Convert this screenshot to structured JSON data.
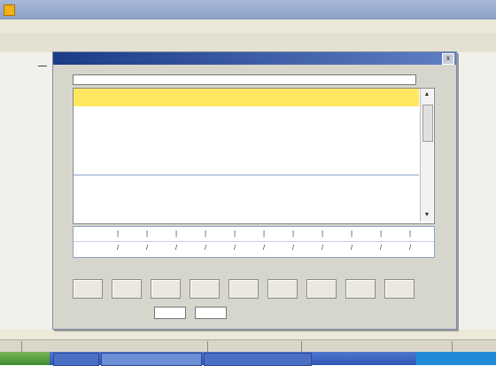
{
  "app": {
    "title": "",
    "window_buttons": "",
    "menus": [
      "",
      "",
      "",
      ""
    ]
  },
  "doc": {
    "side_letter": ""
  },
  "dialog": {
    "title": "",
    "close_glyph": "x",
    "formula": "",
    "table": {
      "columns": [
        "",
        "",
        "",
        "",
        "",
        "",
        "",
        "",
        "",
        "",
        ""
      ],
      "rows": [
        [
          "",
          "",
          "",
          "",
          "",
          "",
          "",
          "",
          "",
          "",
          ""
        ],
        [
          "",
          "",
          "",
          "",
          "",
          "",
          "",
          "",
          "",
          "",
          ""
        ],
        [
          "",
          "",
          "",
          "",
          "",
          "",
          "",
          "",
          "",
          "",
          ""
        ],
        [
          "",
          "",
          "",
          "",
          "",
          "",
          "",
          "",
          "",
          "",
          ""
        ],
        [
          "",
          "",
          "",
          "",
          "",
          "",
          "",
          "",
          "",
          "",
          ""
        ],
        [
          "",
          "",
          "",
          "",
          "",
          "",
          "",
          "",
          "",
          "",
          ""
        ]
      ]
    },
    "grid_rows": [
      "",
      ""
    ],
    "buttons": [
      "",
      "",
      "",
      "",
      "",
      "",
      "",
      "",
      ""
    ],
    "options": [
      "",
      "",
      "",
      "",
      "",
      "",
      "",
      ""
    ]
  },
  "status": [
    "",
    "",
    "",
    "",
    "",
    ""
  ],
  "taskbar": {
    "start": "",
    "tasks": [
      "",
      "",
      ""
    ],
    "tray": ""
  },
  "colors": {
    "header_yellow": "#ffe860",
    "row_label_red": "#c0301a",
    "dialog_title_blue": "#1a3b86"
  },
  "icons": [
    "app-icon",
    "close-icon",
    "scroll-up-icon",
    "scroll-down-icon",
    "start-icon"
  ]
}
